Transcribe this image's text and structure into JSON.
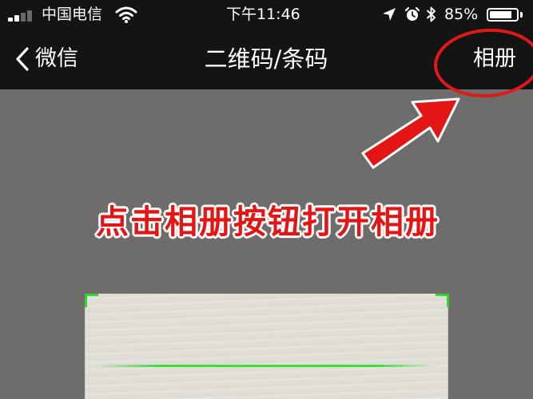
{
  "status_bar": {
    "carrier": "中国电信",
    "time": "下午11:46",
    "battery_percent": "85%",
    "battery_level": 0.85,
    "icons": [
      "signal-icon",
      "wifi-icon",
      "location-arrow-icon",
      "alarm-icon",
      "bluetooth-icon",
      "battery-icon"
    ]
  },
  "nav": {
    "back_label": "微信",
    "title": "二维码/条码",
    "album_button": "相册"
  },
  "annotation": {
    "text": "点击相册按钮打开相册",
    "color": "#e31515"
  },
  "colors": {
    "scan_corner": "#2bd82b",
    "scan_line": "#3cdc3c",
    "topbar": "#141414"
  }
}
